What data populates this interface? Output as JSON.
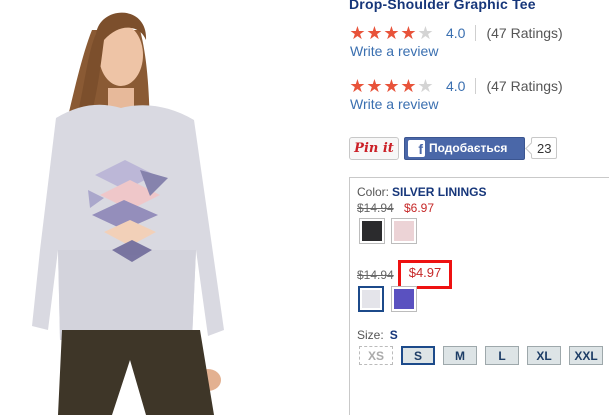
{
  "product": {
    "title": "Drop-Shoulder Graphic Tee"
  },
  "ratings": [
    {
      "stars": 4,
      "score": "4.0",
      "count": "(47 Ratings)",
      "write_review": "Write a review"
    },
    {
      "stars": 4,
      "score": "4.0",
      "count": "(47 Ratings)",
      "write_review": "Write a review"
    }
  ],
  "social": {
    "pin_label": "Pin it",
    "fb_label": "Подобається",
    "fb_count": "23"
  },
  "options": {
    "color_label": "Color:",
    "color_value": "SILVER LININGS",
    "group1": {
      "old_price": "$14.94",
      "new_price": "$6.97"
    },
    "group2": {
      "old_price": "$14.94",
      "new_price": "$4.97"
    },
    "size_label": "Size:",
    "size_value": "S",
    "sizes": [
      "XS",
      "S",
      "M",
      "L",
      "XL",
      "XXL"
    ]
  },
  "colors": {
    "title": "#16367a",
    "star_on": "#e8533a",
    "link": "#3a6fb0",
    "sale_price": "#c62828",
    "highlight": "#ee1111",
    "swatch_black": "#2b2b2d",
    "swatch_pink": "#ecd3d6",
    "swatch_silver": "#e4e4ea",
    "swatch_purple": "#5a51c0"
  },
  "icons": {
    "facebook": "facebook-icon",
    "star": "star-icon",
    "pinterest": "pinterest-icon"
  }
}
